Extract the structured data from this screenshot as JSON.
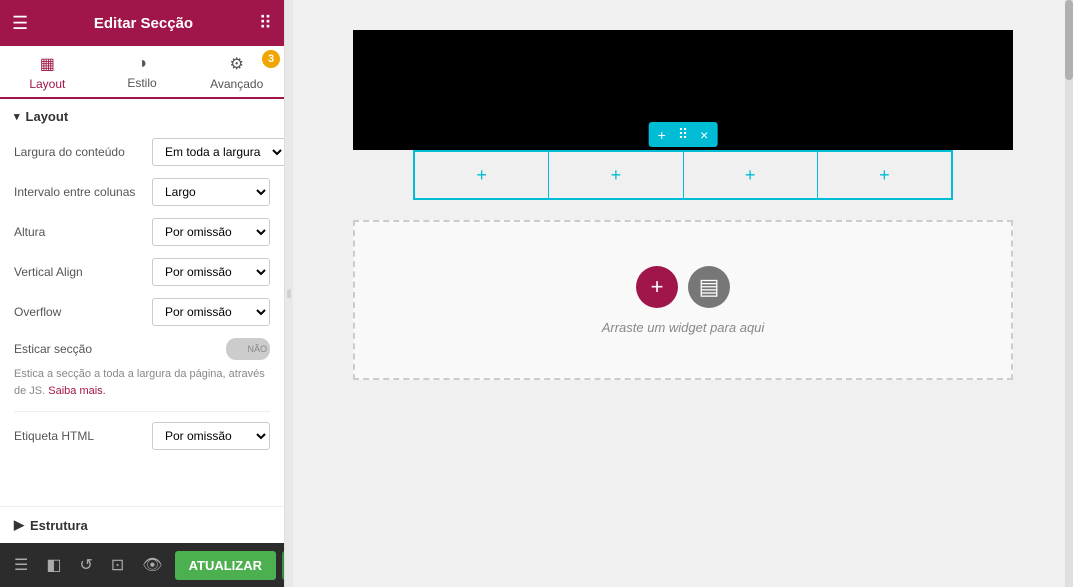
{
  "header": {
    "title": "Editar Secção",
    "hamburger": "☰",
    "grid": "⠿"
  },
  "badge": "3",
  "tabs": [
    {
      "id": "layout",
      "label": "Layout",
      "icon": "▦",
      "active": true
    },
    {
      "id": "estilo",
      "label": "Estilo",
      "icon": "◑",
      "active": false
    },
    {
      "id": "avancado",
      "label": "Avançado",
      "icon": "⚙",
      "active": false
    }
  ],
  "layout_section": {
    "label": "Layout",
    "arrow": "▾"
  },
  "fields": [
    {
      "id": "largura",
      "label": "Largura do conteúdo",
      "value": "Em toda a largura"
    },
    {
      "id": "intervalo",
      "label": "Intervalo entre colunas",
      "value": "Largo"
    },
    {
      "id": "altura",
      "label": "Altura",
      "value": "Por omissão"
    },
    {
      "id": "vertical_align",
      "label": "Vertical Align",
      "value": "Por omissão"
    },
    {
      "id": "overflow",
      "label": "Overflow",
      "value": "Por omissão"
    }
  ],
  "esticar": {
    "label": "Esticar secção",
    "toggle_text": "NÃO"
  },
  "hint": {
    "text": "Estica a secção a toda a largura da página, através de JS.",
    "link_text": "Saiba mais."
  },
  "etiqueta": {
    "label": "Etiqueta HTML",
    "value": "Por omissão"
  },
  "estrutura": {
    "label": "Estrutura",
    "arrow": "▶"
  },
  "bottom_bar": {
    "update_label": "ATUALIZAR",
    "arrow": "▲"
  },
  "canvas": {
    "columns_toolbar_plus": "+",
    "columns_toolbar_move": "⠿",
    "columns_toolbar_close": "×",
    "add_cell": "+",
    "widget_drop_text": "Arraste um widget para aqui"
  }
}
